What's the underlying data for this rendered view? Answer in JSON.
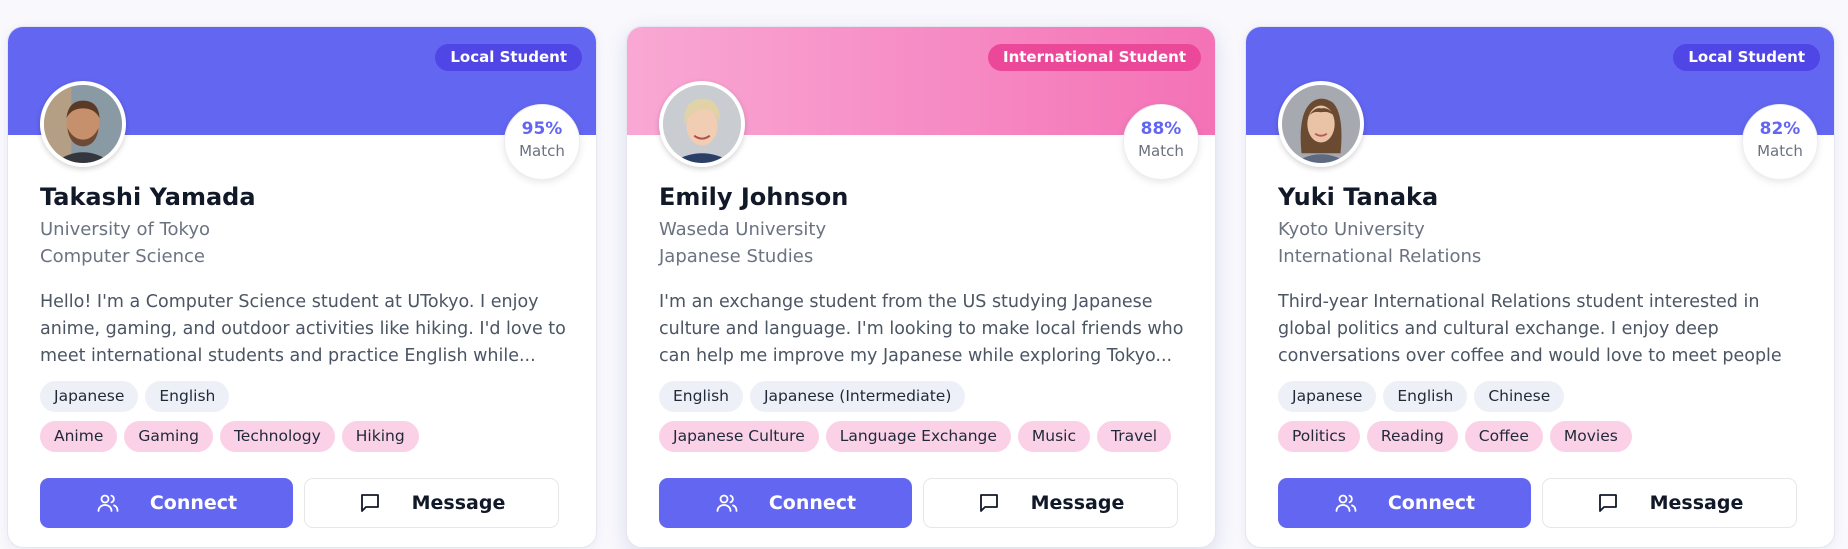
{
  "colors": {
    "accent": "#6366f1",
    "accent_dark": "#4f46e5",
    "pink": "#ec4899",
    "pink_light": "#f9a8d4",
    "interest_tag_bg": "#fbd1e7",
    "language_tag_bg": "#eef0f8"
  },
  "actions": {
    "connect_label": "Connect",
    "message_label": "Message",
    "connect_icon": "users-icon",
    "message_icon": "message-square-icon"
  },
  "cards": [
    {
      "type_badge": "Local Student",
      "theme": "indigo",
      "match_value": "95%",
      "match_label": "Match",
      "name": "Takashi Yamada",
      "university": "University of Tokyo",
      "major": "Computer Science",
      "bio": "Hello! I'm a Computer Science student at UTokyo. I enjoy anime, gaming, and outdoor activities like hiking. I'd love to meet international students and practice English while...",
      "languages": [
        "Japanese",
        "English"
      ],
      "interests": [
        "Anime",
        "Gaming",
        "Technology",
        "Hiking"
      ]
    },
    {
      "type_badge": "International Student",
      "theme": "pink",
      "match_value": "88%",
      "match_label": "Match",
      "name": "Emily Johnson",
      "university": "Waseda University",
      "major": "Japanese Studies",
      "bio": "I'm an exchange student from the US studying Japanese culture and language. I'm looking to make local friends who can help me improve my Japanese while exploring Tokyo...",
      "languages": [
        "English",
        "Japanese (Intermediate)"
      ],
      "interests": [
        "Japanese Culture",
        "Language Exchange",
        "Music",
        "Travel"
      ]
    },
    {
      "type_badge": "Local Student",
      "theme": "indigo",
      "match_value": "82%",
      "match_label": "Match",
      "name": "Yuki Tanaka",
      "university": "Kyoto University",
      "major": "International Relations",
      "bio": "Third-year International Relations student interested in global politics and cultural exchange. I enjoy deep conversations over coffee and would love to meet people from different...",
      "languages": [
        "Japanese",
        "English",
        "Chinese"
      ],
      "interests": [
        "Politics",
        "Reading",
        "Coffee",
        "Movies"
      ]
    }
  ]
}
